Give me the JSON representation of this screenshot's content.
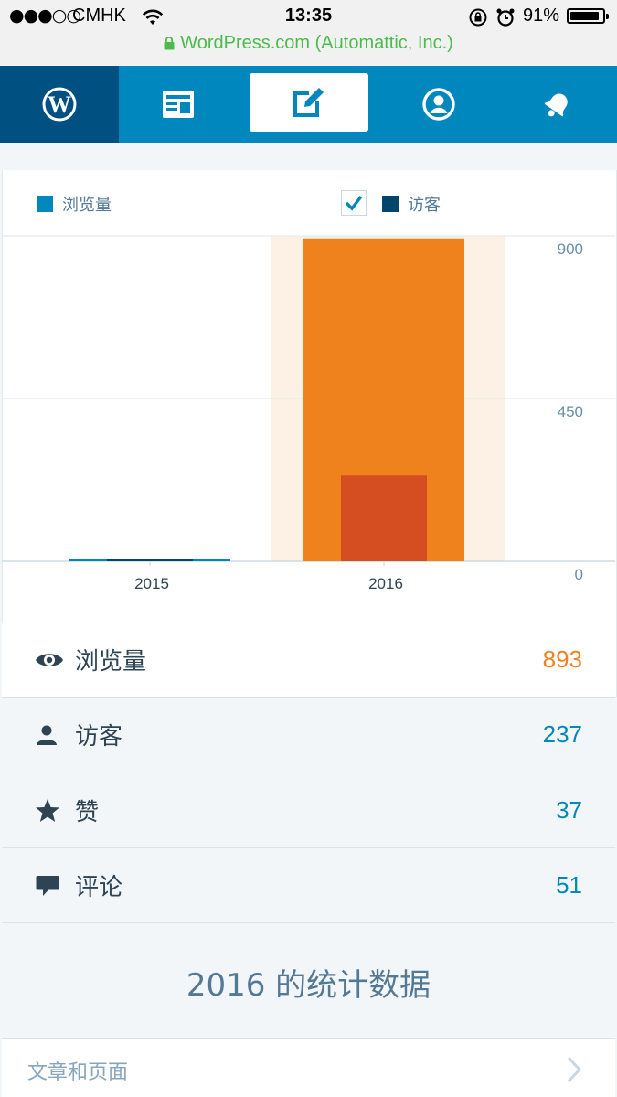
{
  "status_bar": {
    "carrier": "CMHK",
    "time": "13:35",
    "battery": "91%",
    "battery_level": 0.91,
    "url": "WordPress.com (Automattic, Inc.)"
  },
  "nav": {
    "items": [
      {
        "icon": "wordpress-logo-icon"
      },
      {
        "icon": "reader-icon"
      },
      {
        "icon": "write-post-icon"
      },
      {
        "icon": "me-profile-icon"
      },
      {
        "icon": "notifications-bell-icon"
      }
    ]
  },
  "legend": {
    "views": "浏览量",
    "visitors": "访客"
  },
  "colors": {
    "views": "#f0821e",
    "visitors": "#d54e21",
    "views_legend": "#0087be",
    "visitors_legend": "#00456a",
    "selected_bg": "#fdf0e4"
  },
  "chart_data": {
    "type": "bar",
    "categories": [
      "2015",
      "2016"
    ],
    "series": [
      {
        "name": "浏览量",
        "values": [
          3,
          893
        ]
      },
      {
        "name": "访客",
        "values": [
          1,
          237
        ]
      }
    ],
    "y_ticks": [
      "900",
      "450",
      "0"
    ],
    "ylim": [
      0,
      900
    ],
    "selected": "2016",
    "grid": true,
    "legend_position": "top"
  },
  "stats": [
    {
      "icon": "eye-icon",
      "label": "浏览量",
      "value": "893"
    },
    {
      "icon": "person-icon",
      "label": "访客",
      "value": "237"
    },
    {
      "icon": "star-icon",
      "label": "赞",
      "value": "37"
    },
    {
      "icon": "comment-icon",
      "label": "评论",
      "value": "51"
    }
  ],
  "year_title": "2016 的统计数据",
  "list": {
    "posts_pages": "文章和页面"
  }
}
